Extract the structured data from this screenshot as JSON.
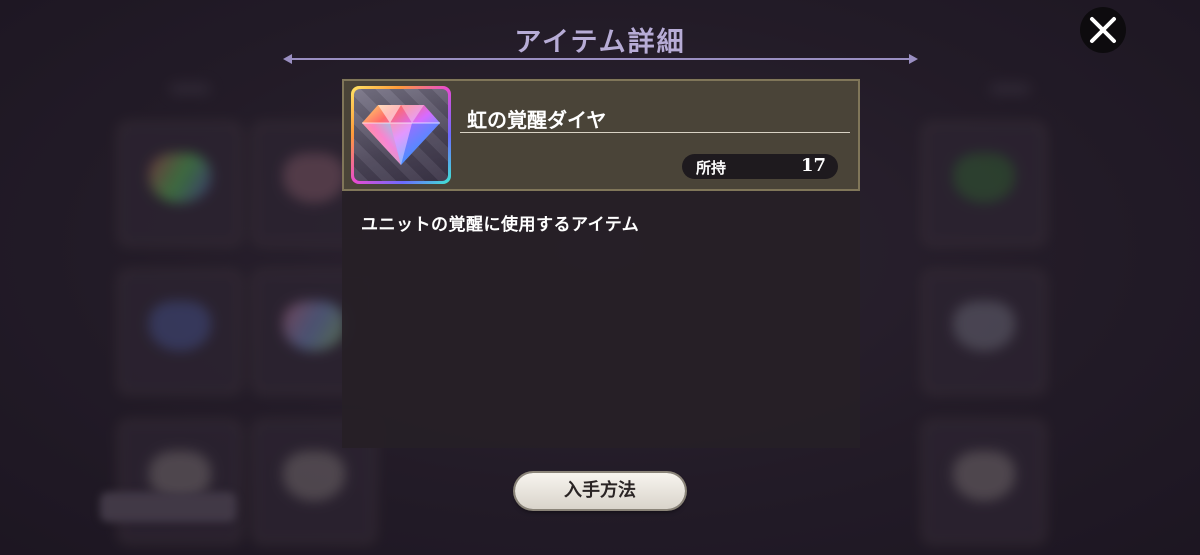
{
  "header": {
    "title": "アイテム詳細"
  },
  "close": {
    "icon": "close-icon"
  },
  "item": {
    "name": "虹の覚醒ダイヤ",
    "icon": "rainbow-diamond-icon",
    "owned_label": "所持",
    "owned_count": "17",
    "description": "ユニットの覚醒に使用するアイテム"
  },
  "actions": {
    "obtain_label": "入手方法"
  },
  "colors": {
    "title": "#b7acd6",
    "header_bg": "#4a4438",
    "header_border": "#807659",
    "panel_bg": "#261f26",
    "button_bg": "#f7f4ee"
  }
}
